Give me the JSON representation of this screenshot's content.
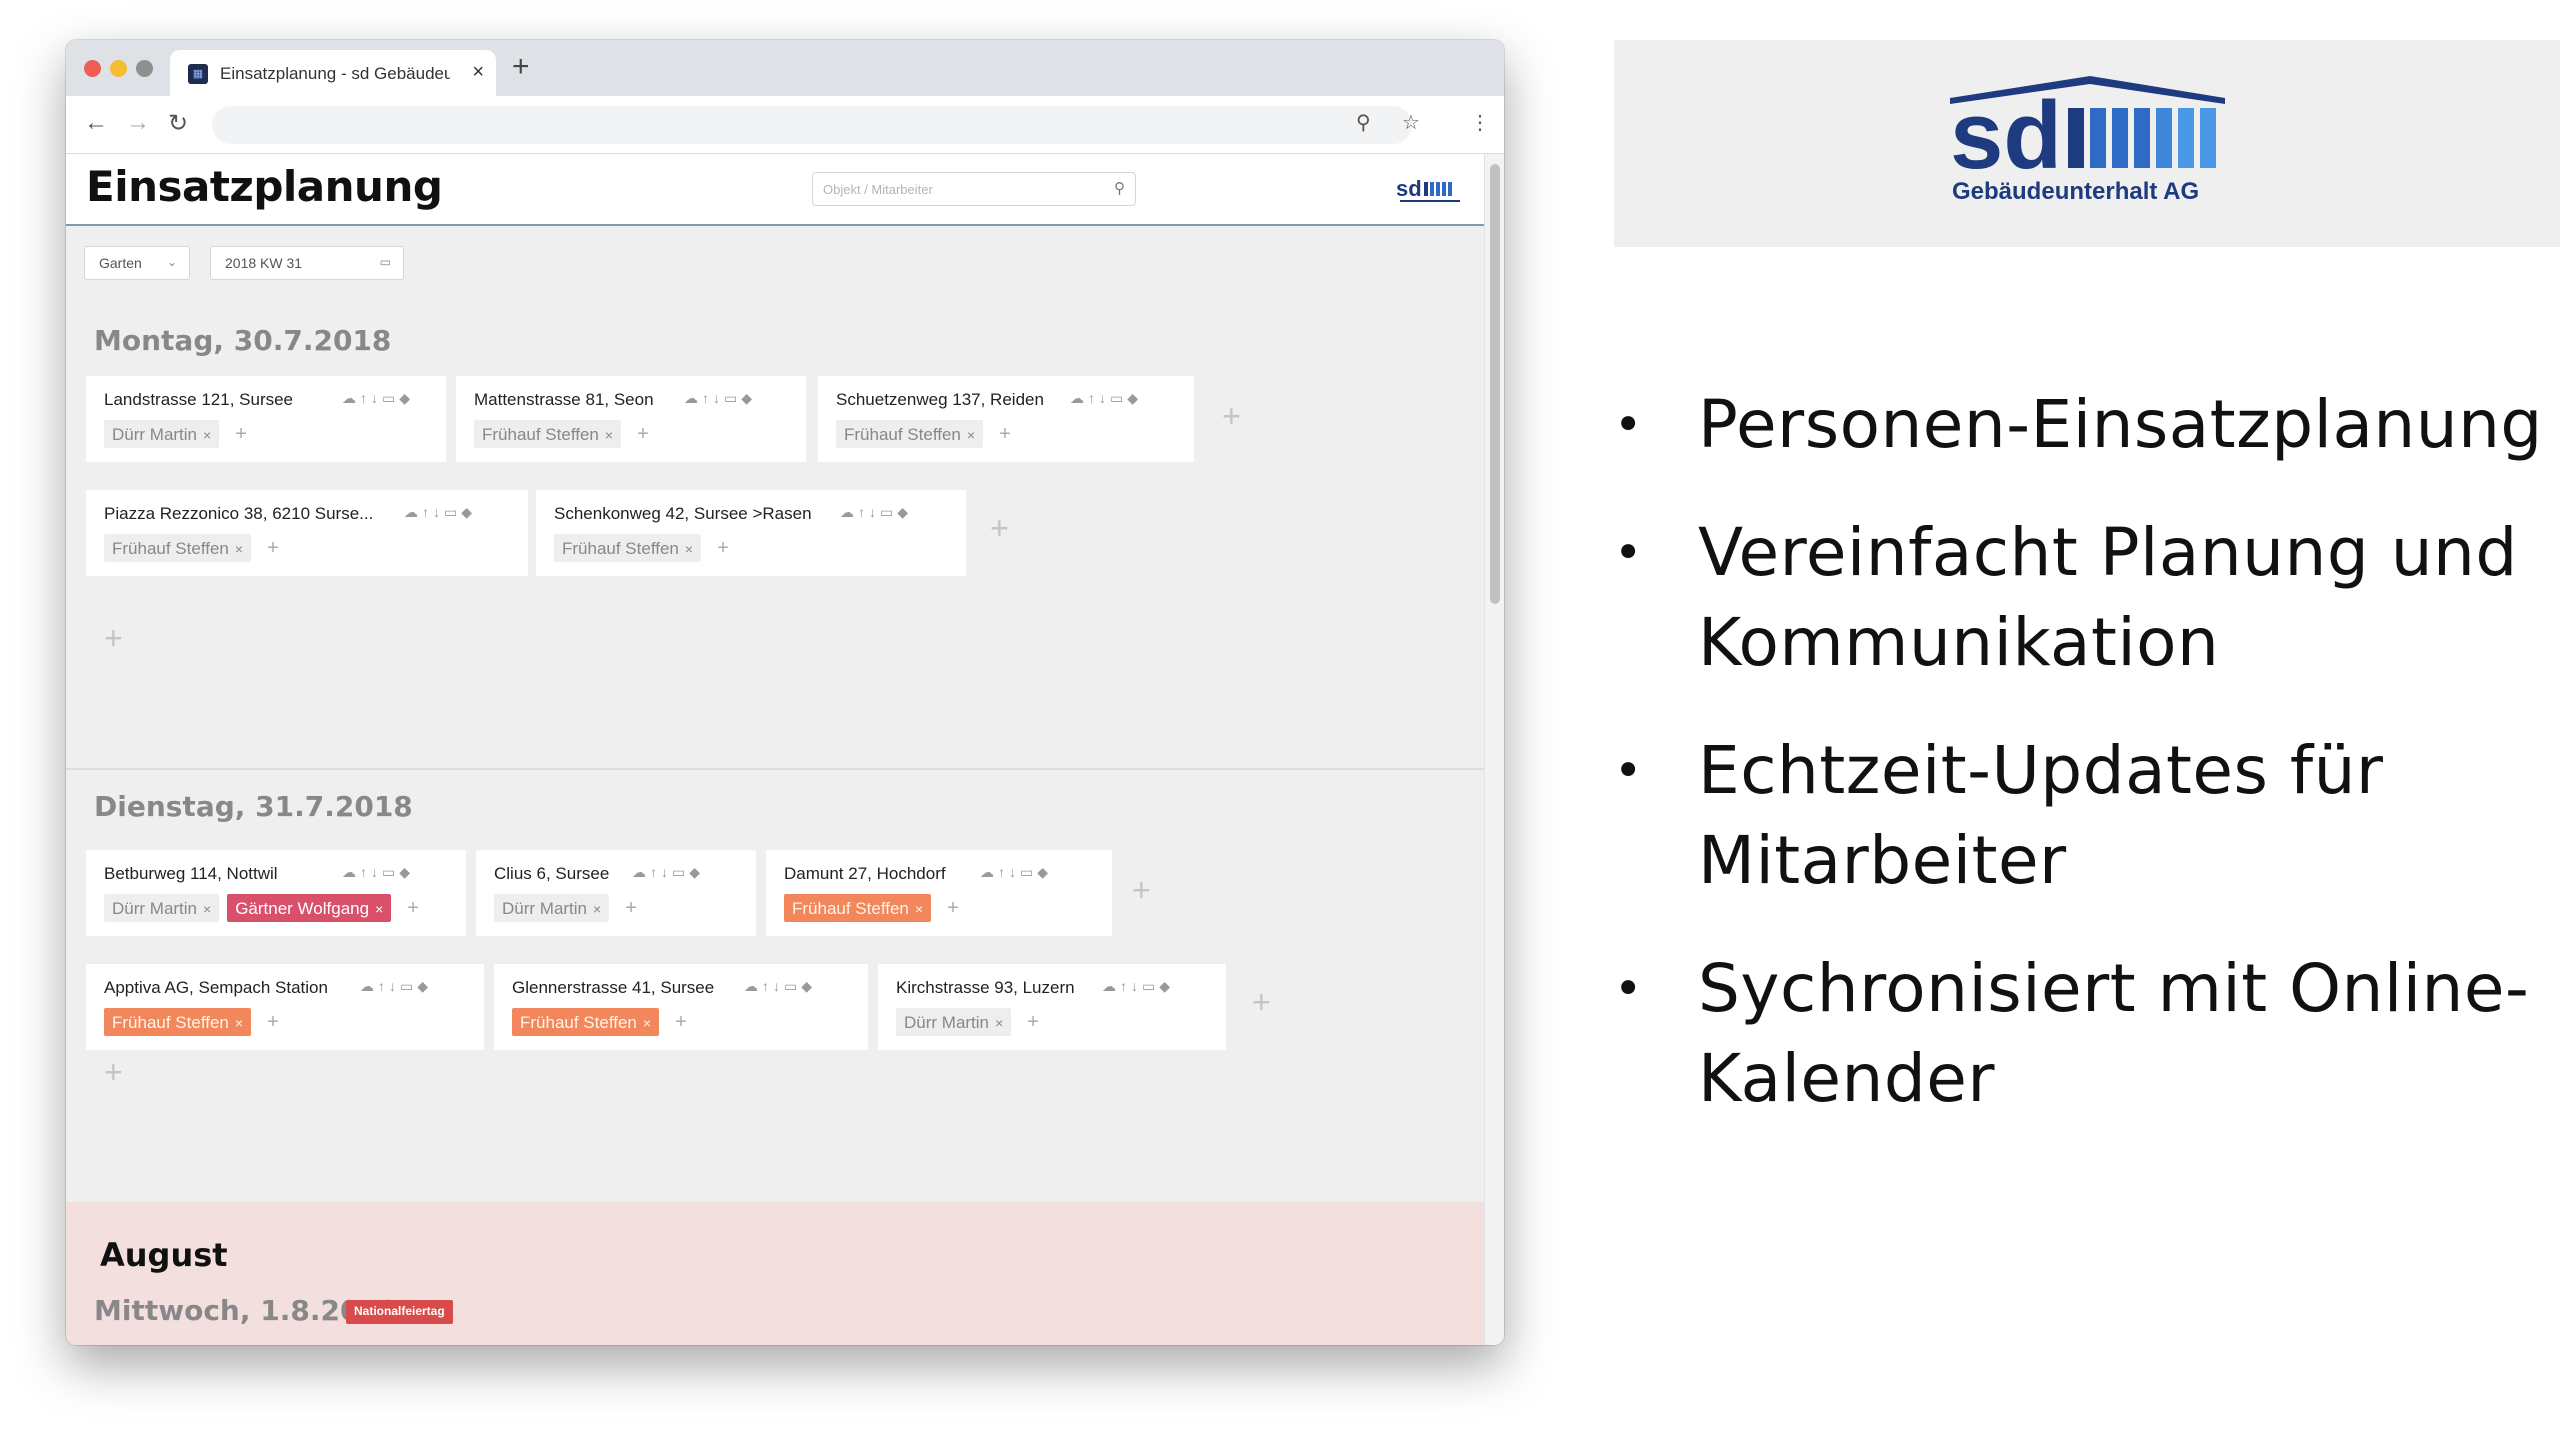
{
  "browser": {
    "tab_title": "Einsatzplanung - sd Gebäudeu",
    "tab_close": "×",
    "new_tab": "+"
  },
  "app": {
    "title": "Einsatzplanung",
    "search_placeholder": "Objekt / Mitarbeiter",
    "filter_category": "Garten",
    "filter_week": "2018 KW 31"
  },
  "days": [
    {
      "heading": "Montag, 30.7.2018",
      "rows": [
        [
          {
            "title": "Landstrasse 121, Sursee",
            "chips": [
              {
                "label": "Dürr Martin",
                "style": "gray"
              }
            ]
          },
          {
            "title": "Mattenstrasse 81, Seon",
            "chips": [
              {
                "label": "Frühauf Steffen",
                "style": "gray"
              }
            ]
          },
          {
            "title": "Schuetzenweg 137, Reiden",
            "chips": [
              {
                "label": "Frühauf Steffen",
                "style": "gray"
              }
            ]
          }
        ],
        [
          {
            "title": "Piazza Rezzonico 38, 6210 Surse...",
            "chips": [
              {
                "label": "Frühauf Steffen",
                "style": "gray"
              }
            ]
          },
          {
            "title": "Schenkonweg 42, Sursee >Rasen",
            "chips": [
              {
                "label": "Frühauf Steffen",
                "style": "gray"
              }
            ]
          }
        ]
      ]
    },
    {
      "heading": "Dienstag, 31.7.2018",
      "rows": [
        [
          {
            "title": "Betburweg 114, Nottwil",
            "chips": [
              {
                "label": "Dürr Martin",
                "style": "gray"
              },
              {
                "label": "Gärtner Wolfgang",
                "style": "red"
              }
            ]
          },
          {
            "title": "Clius 6, Sursee",
            "chips": [
              {
                "label": "Dürr Martin",
                "style": "gray"
              }
            ]
          },
          {
            "title": "Damunt 27, Hochdorf",
            "chips": [
              {
                "label": "Frühauf Steffen",
                "style": "orange"
              }
            ]
          }
        ],
        [
          {
            "title": "Apptiva AG, Sempach Station",
            "chips": [
              {
                "label": "Frühauf Steffen",
                "style": "orange"
              }
            ]
          },
          {
            "title": "Glennerstrasse 41, Sursee",
            "chips": [
              {
                "label": "Frühauf Steffen",
                "style": "orange"
              }
            ]
          },
          {
            "title": "Kirchstrasse 93, Luzern",
            "chips": [
              {
                "label": "Dürr Martin",
                "style": "gray"
              }
            ]
          }
        ]
      ]
    }
  ],
  "august": {
    "title": "August",
    "day": "Mittwoch, 1.8.2018",
    "badge": "Nationalfeiertag"
  },
  "brand": {
    "logo_text": "Gebäudeunterhalt AG",
    "logo_mark": "sd",
    "navy": "#1e3b80",
    "blue": "#2f6bc4"
  },
  "bullets": [
    "Personen-Einsatzplanung",
    "Vereinfacht Planung und Kommunikation",
    "Echtzeit-Updates für Mitarbeiter",
    "Sychronisiert mit Online-Kalender"
  ],
  "symbols": {
    "chip_remove": "×",
    "add": "+",
    "card_icons": "☁↑↓▭◆",
    "bullet": "•"
  }
}
